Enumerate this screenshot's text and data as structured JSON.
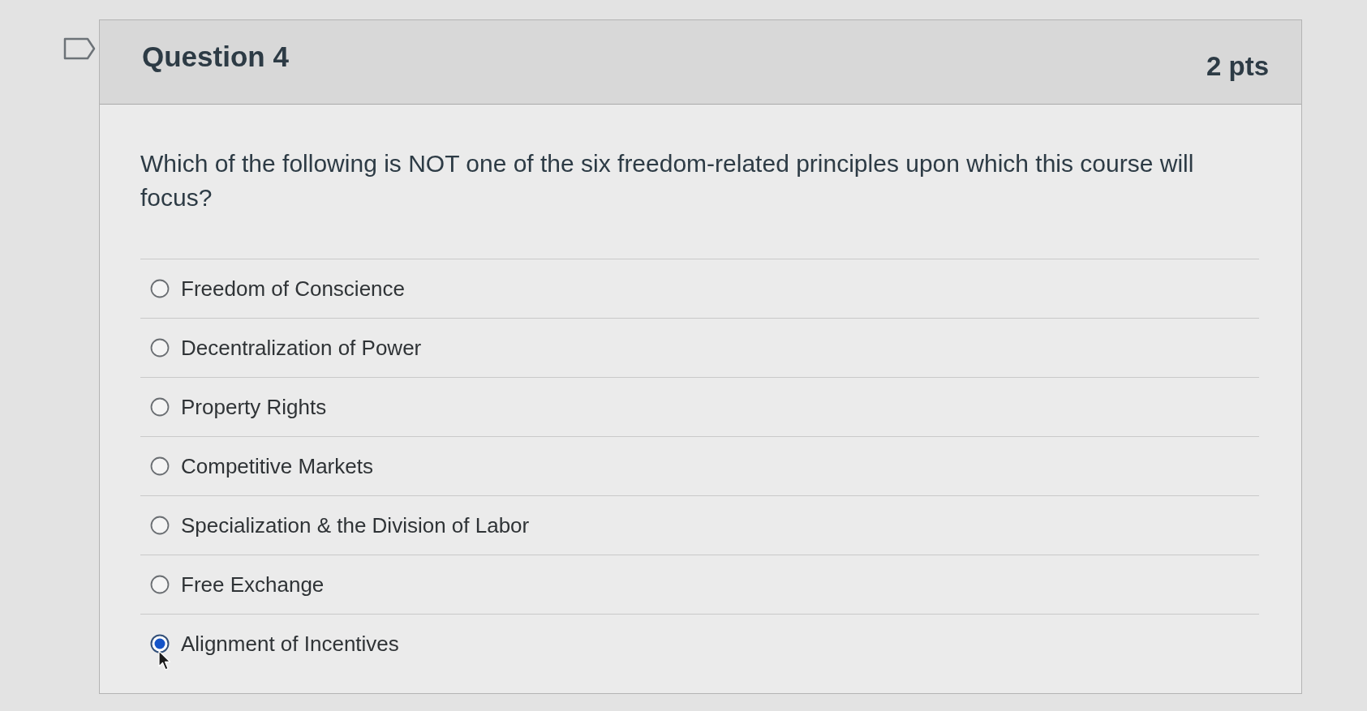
{
  "question": {
    "flagged": false,
    "title": "Question 4",
    "points": "2 pts",
    "text": "Which of the following is NOT one of the six freedom-related principles upon which this course will focus?",
    "options": [
      {
        "label": "Freedom of Conscience",
        "selected": false
      },
      {
        "label": "Decentralization of Power",
        "selected": false
      },
      {
        "label": "Property Rights",
        "selected": false
      },
      {
        "label": "Competitive Markets",
        "selected": false
      },
      {
        "label": "Specialization & the Division of Labor",
        "selected": false
      },
      {
        "label": "Free Exchange",
        "selected": false
      },
      {
        "label": "Alignment of Incentives",
        "selected": true
      }
    ]
  }
}
